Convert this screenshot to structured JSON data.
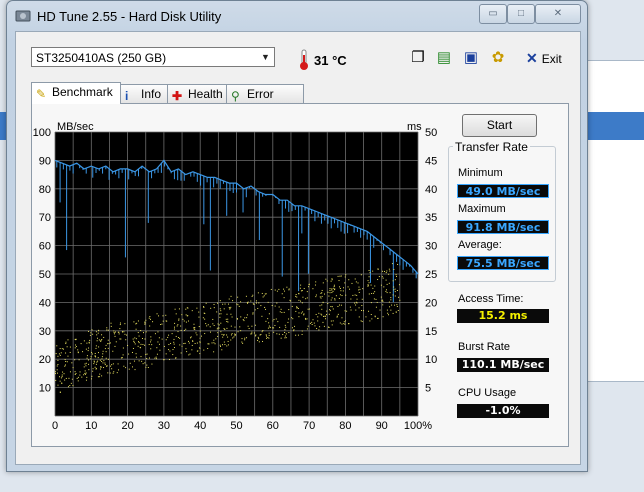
{
  "window": {
    "title": "HD Tune 2.55 - Hard Disk Utility"
  },
  "controls": {
    "minimize": "▭",
    "maximize": "□",
    "close": "✕"
  },
  "drive": {
    "selected": "ST3250410AS (250 GB)"
  },
  "temperature": "31 °C",
  "toolbar": {
    "exit_label": "Exit"
  },
  "tabs": [
    {
      "label": "Benchmark",
      "icon": "pin-icon"
    },
    {
      "label": "Info",
      "icon": "info-icon"
    },
    {
      "label": "Health",
      "icon": "health-cross-icon"
    },
    {
      "label": "Error Scan",
      "icon": "magnifier-icon"
    }
  ],
  "benchmark": {
    "start_label": "Start",
    "transfer_rate_title": "Transfer Rate",
    "minimum_label": "Minimum",
    "minimum_value": "49.0 MB/sec",
    "maximum_label": "Maximum",
    "maximum_value": "91.8 MB/sec",
    "average_label": "Average:",
    "average_value": "75.5 MB/sec",
    "access_time_label": "Access Time:",
    "access_time_value": "15.2 ms",
    "burst_rate_label": "Burst Rate",
    "burst_rate_value": "110.1 MB/sec",
    "cpu_usage_label": "CPU Usage",
    "cpu_usage_value": "-1.0%"
  },
  "colors": {
    "transfer_line": "#3b97e6",
    "access_points": "#e8e060",
    "plot_bg": "#000000",
    "grid": "#6e6e6e"
  },
  "chart_data": {
    "type": "line",
    "left_axis_label": "MB/sec",
    "right_axis_label": "ms",
    "x_ticks": [
      "0",
      "10",
      "20",
      "30",
      "40",
      "50",
      "60",
      "70",
      "80",
      "90",
      "100%"
    ],
    "y_left_ticks": [
      "100",
      "90",
      "80",
      "70",
      "60",
      "50",
      "40",
      "30",
      "20",
      "10"
    ],
    "y_right_ticks": [
      "50",
      "45",
      "40",
      "35",
      "30",
      "25",
      "20",
      "15",
      "10",
      "5"
    ],
    "xlim": [
      0,
      100
    ],
    "ylim_left": [
      0,
      100
    ],
    "ylim_right": [
      0,
      50
    ],
    "grid": true,
    "series": [
      {
        "axis": "left",
        "x": [
          0,
          2,
          4,
          6,
          8,
          10,
          12,
          14,
          16,
          18,
          20,
          22,
          24,
          26,
          28,
          30,
          32,
          34,
          36,
          38,
          40,
          42,
          44,
          46,
          48,
          50,
          52,
          54,
          56,
          58,
          60,
          62,
          64,
          66,
          68,
          70,
          72,
          74,
          76,
          78,
          80,
          82,
          84,
          86,
          88,
          90,
          92,
          94,
          96,
          98,
          100
        ],
        "y": [
          90,
          89,
          88,
          89,
          87,
          88,
          87,
          88,
          86,
          87,
          87,
          86,
          88,
          86,
          87,
          90,
          86,
          87,
          85,
          86,
          85,
          84,
          84,
          83,
          82,
          82,
          80,
          81,
          79,
          78,
          78,
          76,
          76,
          74,
          74,
          73,
          72,
          71,
          70,
          69,
          68,
          67,
          66,
          65,
          63,
          61,
          59,
          57,
          55,
          53,
          50
        ]
      },
      {
        "axis": "right",
        "x": [
          0,
          5,
          10,
          15,
          20,
          25,
          30,
          35,
          40,
          45,
          50,
          55,
          60,
          65,
          70,
          75,
          80,
          85,
          90,
          95
        ],
        "y": [
          8,
          10,
          11,
          12,
          12.5,
          13,
          14,
          15,
          15.5,
          16,
          17,
          17.5,
          18,
          18.5,
          19,
          20,
          20.5,
          21,
          22,
          23
        ]
      }
    ]
  }
}
